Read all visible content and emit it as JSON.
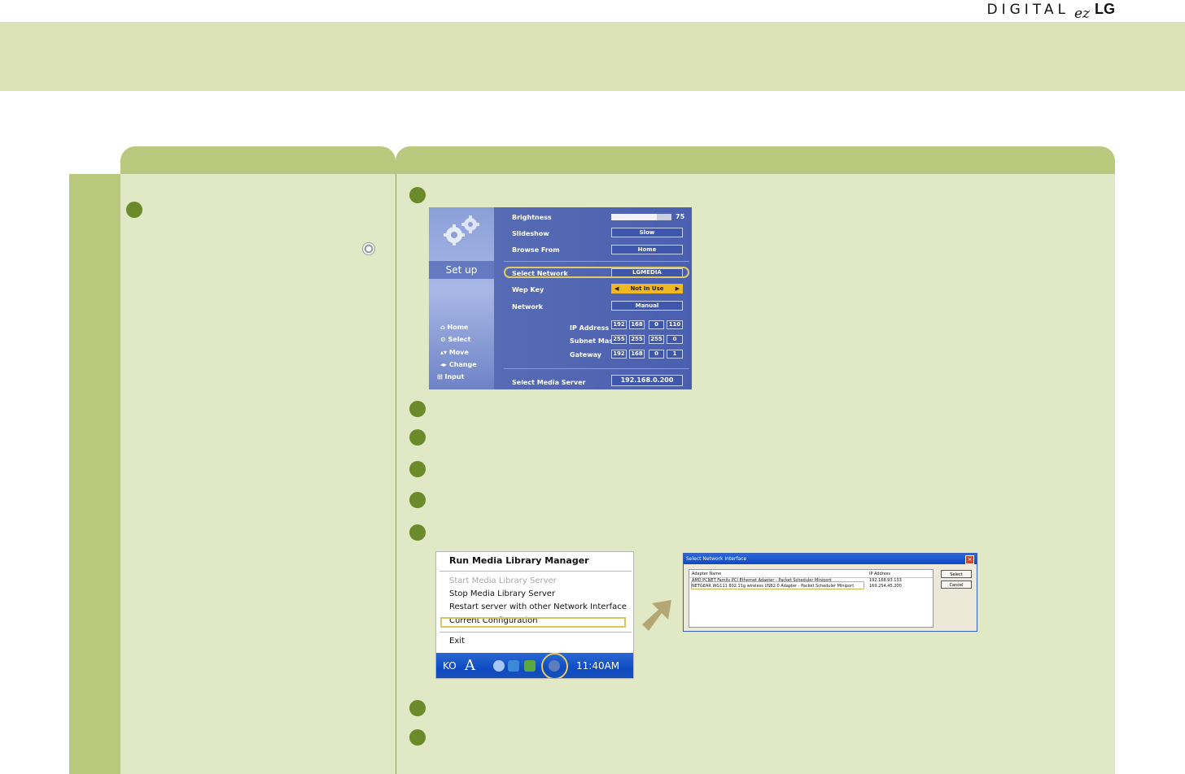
{
  "brand": {
    "digital": "DIGITAL",
    "ez": "ez",
    "lg": "LG"
  },
  "colors": {
    "band": "#dbe2b6",
    "tab": "#bac97d",
    "panel": "#e1e8c6",
    "bullet": "#6b8a2a",
    "highlight": "#e2cc62"
  },
  "setup_screen": {
    "title": "Set up",
    "legend": [
      "Home",
      "Select",
      "Move",
      "Change",
      "Input"
    ],
    "brightness": {
      "label": "Brightness",
      "value": "75",
      "level": 0.75
    },
    "slideshow": {
      "label": "Slideshow",
      "value": "Slow"
    },
    "browse_from": {
      "label": "Browse From",
      "value": "Home"
    },
    "select_network": {
      "label": "Select Network",
      "value": "LGMEDIA"
    },
    "wep_key": {
      "label": "Wep Key",
      "value": "Not In Use"
    },
    "network": {
      "label": "Network",
      "value": "Manual"
    },
    "ip_address": {
      "label": "IP Address",
      "octets": [
        "192",
        "168",
        "0",
        "110"
      ]
    },
    "subnet_mask": {
      "label": "Subnet Mask",
      "octets": [
        "255",
        "255",
        "255",
        "0"
      ]
    },
    "gateway": {
      "label": "Gateway",
      "octets": [
        "192",
        "168",
        "0",
        "1"
      ]
    },
    "media_server": {
      "label": "Select Media Server",
      "value": "192.168.0.200"
    }
  },
  "tray_menu": {
    "title": "Run Media Library Manager",
    "items": [
      "Start Media Library Server",
      "Stop Media Library Server",
      "Restart server with other Network Interface",
      "Current Configuration"
    ],
    "exit": "Exit",
    "taskbar": {
      "lang": "KO",
      "ime": "A",
      "clock": "11:40AM"
    }
  },
  "dialog": {
    "title": "Select Network Interface",
    "columns": [
      "Adapter Name",
      "IP Address"
    ],
    "rows": [
      {
        "name": "AMD PCNET Family PCI Ethernet Adapter - Packet Scheduler Miniport",
        "ip": "192.168.93.133"
      },
      {
        "name": "NETGEAR WG111 802.11g wireless USB2.0 Adapter - Packet Scheduler Miniport",
        "ip": "169.254.45.200"
      }
    ],
    "select_label": "Select",
    "cancel_label": "Cancel",
    "close_glyph": "×"
  }
}
